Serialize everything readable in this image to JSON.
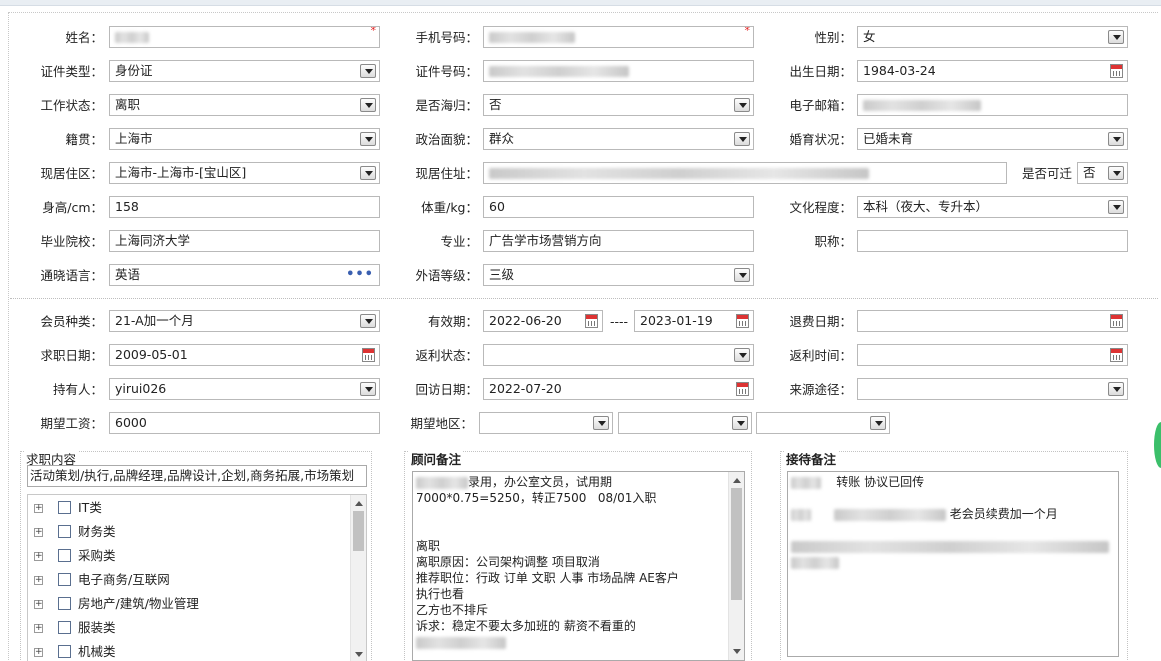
{
  "basic": {
    "name": {
      "label": "姓名：",
      "required_mark": "*"
    },
    "phone": {
      "label": "手机号码：",
      "required_mark": "*"
    },
    "gender": {
      "label": "性别：",
      "value": "女"
    },
    "id_type": {
      "label": "证件类型：",
      "value": "身份证"
    },
    "id_number": {
      "label": "证件号码："
    },
    "birth_date": {
      "label": "出生日期：",
      "value": "1984-03-24"
    },
    "work_status": {
      "label": "工作状态：",
      "value": "离职"
    },
    "returnee": {
      "label": "是否海归：",
      "value": "否"
    },
    "email": {
      "label": "电子邮箱："
    },
    "native_place": {
      "label": "籍贯：",
      "value": "上海市"
    },
    "political": {
      "label": "政治面貌：",
      "value": "群众"
    },
    "marital": {
      "label": "婚育状况：",
      "value": "已婚未育"
    },
    "residence_area": {
      "label": "现居住区：",
      "value": "上海市-上海市-[宝山区]"
    },
    "address": {
      "label": "现居住址："
    },
    "relocate": {
      "label": "是否可迁",
      "value": "否"
    },
    "height": {
      "label": "身高/cm：",
      "value": "158"
    },
    "weight": {
      "label": "体重/kg：",
      "value": "60"
    },
    "education": {
      "label": "文化程度：",
      "value": "本科（夜大、专升本）"
    },
    "school": {
      "label": "毕业院校：",
      "value": "上海同济大学"
    },
    "major": {
      "label": "专业：",
      "value": "广告学市场营销方向"
    },
    "title": {
      "label": "职称：",
      "value": ""
    },
    "language": {
      "label": "通晓语言：",
      "value": "英语"
    },
    "foreign_level": {
      "label": "外语等级：",
      "value": "三级"
    }
  },
  "membership": {
    "member_type": {
      "label": "会员种类：",
      "value": "21-A加一个月"
    },
    "valid_period": {
      "label": "有效期：",
      "start": "2022-06-20",
      "separator": "----",
      "end": "2023-01-19"
    },
    "refund_date": {
      "label": "退费日期：",
      "value": ""
    },
    "job_date": {
      "label": "求职日期：",
      "value": "2009-05-01"
    },
    "rebate_status": {
      "label": "返利状态：",
      "value": ""
    },
    "rebate_time": {
      "label": "返利时间：",
      "value": ""
    },
    "holder": {
      "label": "持有人：",
      "value": "yirui026"
    },
    "visit_date": {
      "label": "回访日期：",
      "value": "2022-07-20"
    },
    "source": {
      "label": "来源途径：",
      "value": ""
    },
    "salary": {
      "label": "期望工资：",
      "value": "6000"
    },
    "region": {
      "label": "期望地区：",
      "values": [
        "",
        "",
        ""
      ]
    }
  },
  "job_content": {
    "title": "求职内容",
    "summary": "活动策划/执行,品牌经理,品牌设计,企划,商务拓展,市场策划",
    "tree": [
      {
        "label": "IT类"
      },
      {
        "label": "财务类"
      },
      {
        "label": "采购类"
      },
      {
        "label": "电子商务/互联网"
      },
      {
        "label": "房地产/建筑/物业管理"
      },
      {
        "label": "服装类"
      },
      {
        "label": "机械类"
      }
    ]
  },
  "advisor_notes": {
    "title": "顾问备注",
    "lines": [
      "录用，办公室文员，试用期",
      "7000*0.75=5250，转正7500   08/01入职",
      "",
      "",
      "离职",
      "离职原因：公司架构调整 项目取消",
      "推荐职位：行政 订单 文职 人事 市场品牌 AE客户",
      "执行也看",
      "乙方也不排斥",
      "诉求：稳定不要太多加班的 薪资不看重的"
    ]
  },
  "reception_notes": {
    "title": "接待备注",
    "lines": [
      "转账 协议已回传",
      "老会员续费加一个月"
    ]
  }
}
